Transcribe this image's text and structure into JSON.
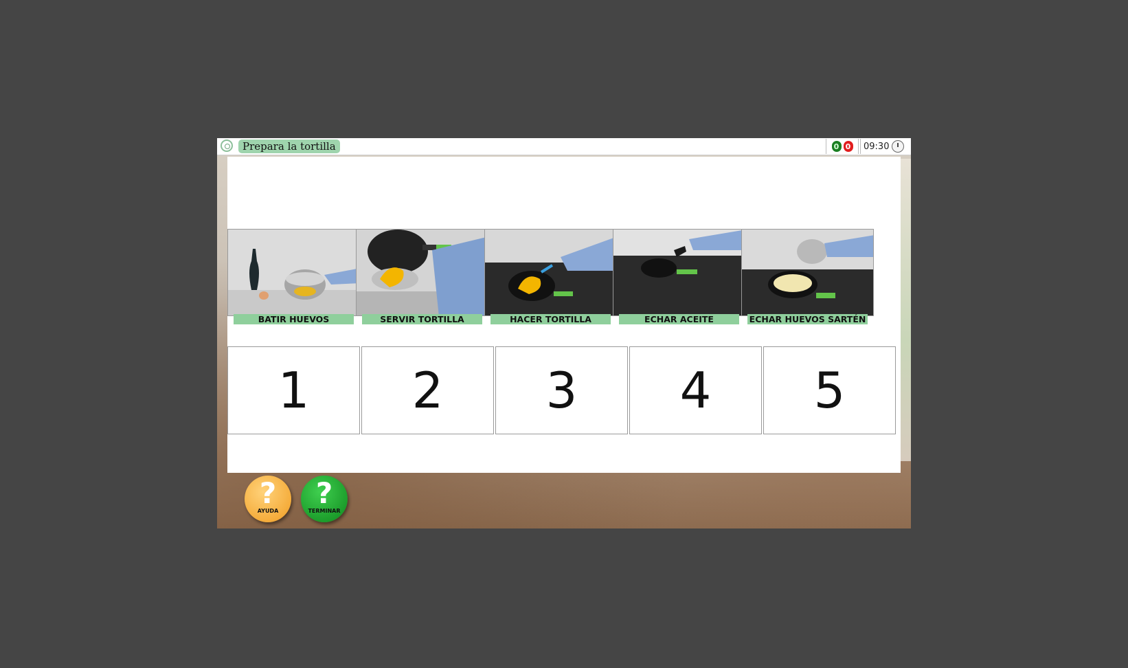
{
  "header": {
    "title": "Prepara la tortilla",
    "score_correct": "0",
    "score_wrong": "0",
    "timer": "09:30"
  },
  "cards": [
    {
      "label": "BATIR HUEVOS",
      "icon": "whisk-eggs-photo"
    },
    {
      "label": "SERVIR TORTILLA",
      "icon": "serve-omelette-photo"
    },
    {
      "label": "HACER TORTILLA",
      "icon": "cook-omelette-photo"
    },
    {
      "label": "ECHAR ACEITE",
      "icon": "pour-oil-photo"
    },
    {
      "label": "ECHAR HUEVOS SARTÉN",
      "icon": "pour-eggs-pan-photo"
    }
  ],
  "slots": [
    "1",
    "2",
    "3",
    "4",
    "5"
  ],
  "buttons": {
    "help_label": "AYUDA",
    "end_label": "TERMINAR",
    "help_glyph": "?",
    "end_glyph": "?"
  },
  "colors": {
    "label_green": "#8fcf9c",
    "title_green": "#9fd4ad",
    "help_orange": "#f5ad3c",
    "end_green": "#1d9e2c",
    "score_ok": "#1b7f22",
    "score_bad": "#e11d1d"
  }
}
